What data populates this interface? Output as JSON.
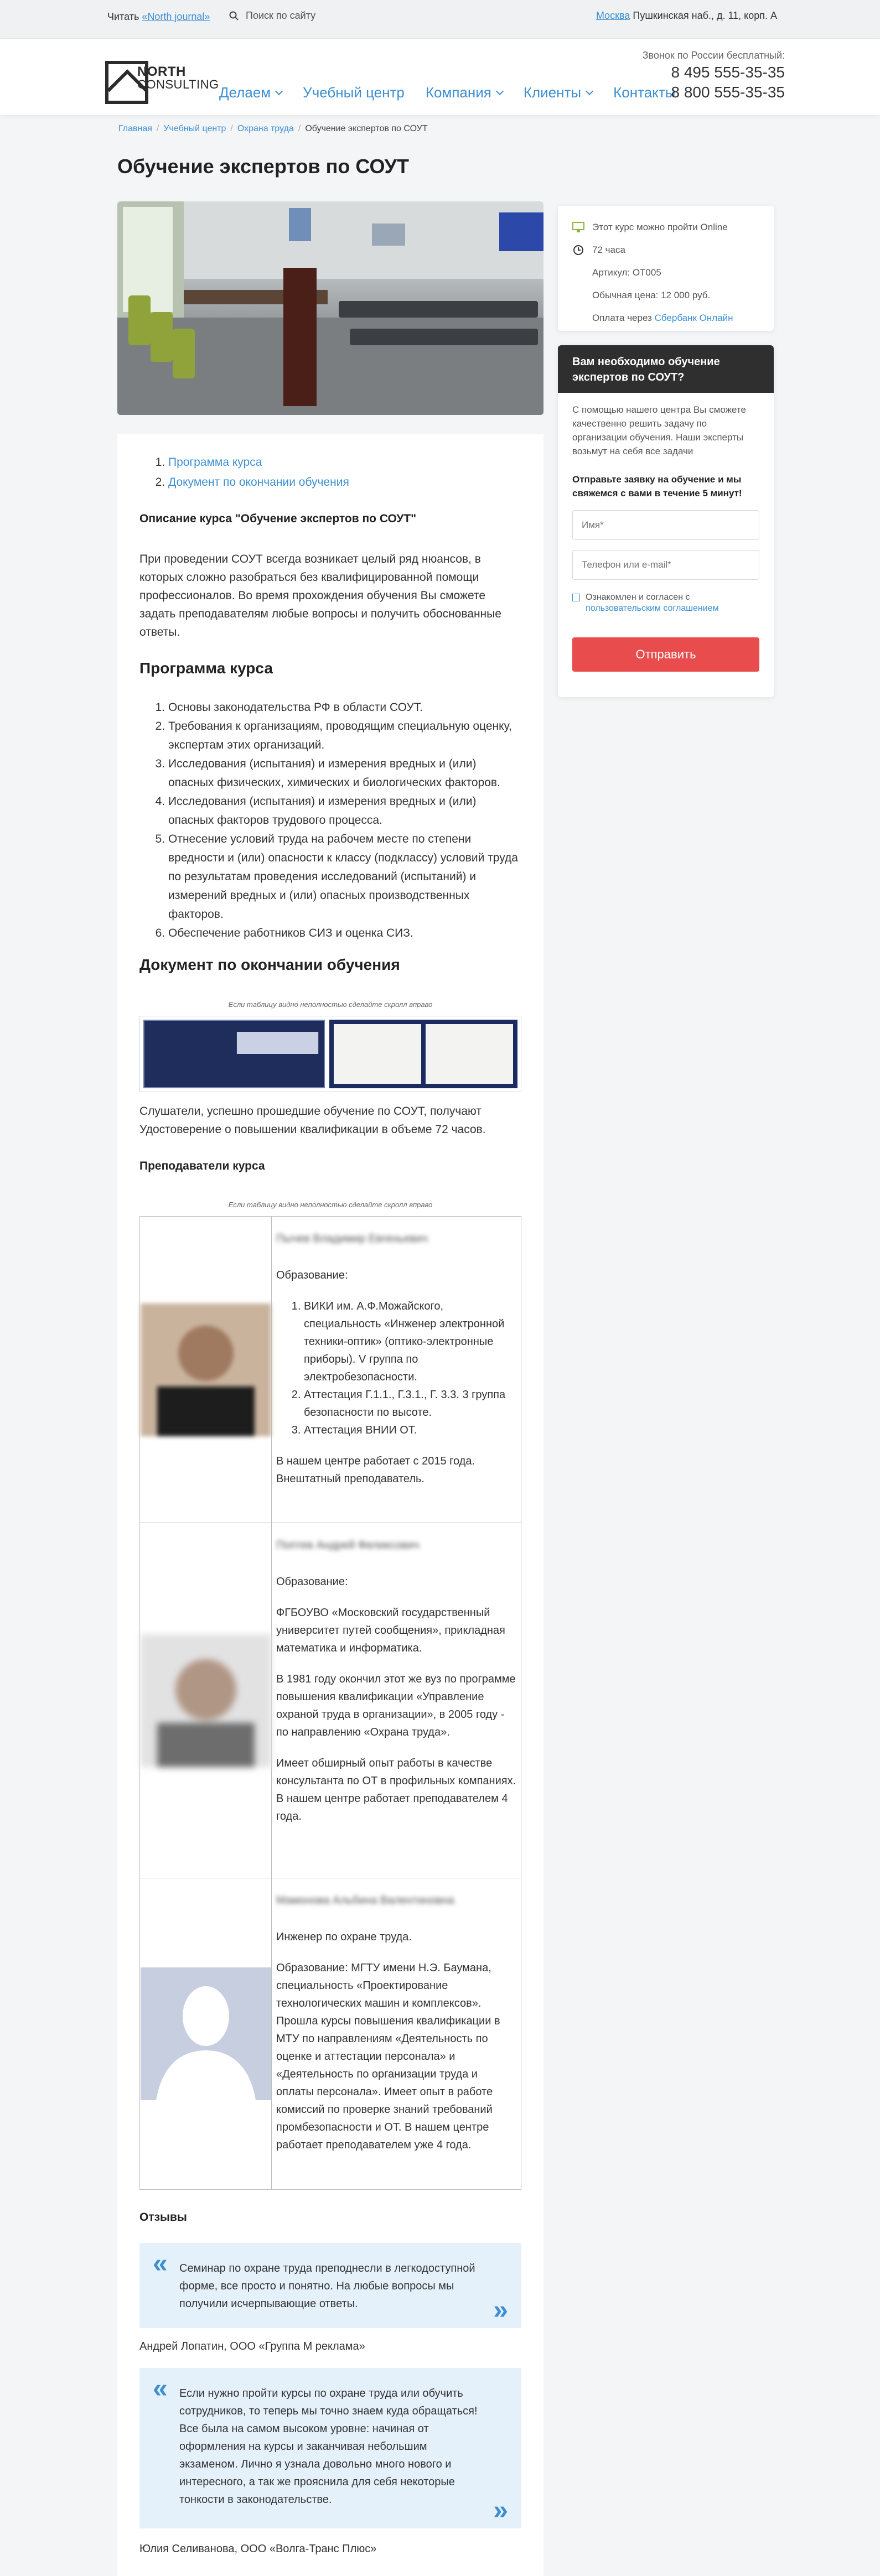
{
  "topbar": {
    "read_prefix": "Читать",
    "read_link": "«North journal»",
    "search_placeholder": "Поиск по сайту",
    "city": "Москва",
    "address": "Пушкинская наб., д. 11, корп. А"
  },
  "header": {
    "logo_line1": "NORTH",
    "logo_line2": "CONSULTING",
    "nav": [
      {
        "label": "Делаем",
        "dropdown": true
      },
      {
        "label": "Учебный центр",
        "dropdown": false
      },
      {
        "label": "Компания",
        "dropdown": true
      },
      {
        "label": "Клиенты",
        "dropdown": true
      },
      {
        "label": "Контакты",
        "dropdown": false
      }
    ],
    "phone_caption": "Звонок по России бесплатный:",
    "phone1": "8 495 555-35-35",
    "phone2": "8 800 555-35-35"
  },
  "breadcrumbs": [
    "Главная",
    "Учебный центр",
    "Охрана труда",
    "Обучение экспертов по СОУТ"
  ],
  "page_title": "Обучение экспертов по СОУТ",
  "info": {
    "online": "Этот курс можно пройти Online",
    "hours": "72 часа",
    "article": "Артикул: ОТ005",
    "price": "Обычная цена: 12 000 руб.",
    "payment_prefix": "Оплата через",
    "payment_link": "Сбербанк Онлайн"
  },
  "request": {
    "title": "Вам необходимо обучение экспертов по СОУТ?",
    "description": "С помощью нашего центра Вы сможете качественно решить задачу по организации обучения. Наши эксперты возьмут на себя все задачи",
    "call_text": "Отправьте заявку на обучение и мы свяжемся с вами в течение 5 минут!",
    "name_placeholder": "Имя*",
    "contact_placeholder": "Телефон или e-mail*",
    "agree_prefix": "Ознакомлен и согласен с",
    "agree_link": "пользовательским соглашением",
    "submit": "Отправить"
  },
  "toc": [
    "Программа курса",
    "Документ по окончании обучения"
  ],
  "description_title": "Описание курса \"Обучение экспертов по СОУТ\"",
  "description_text": "При проведении СОУТ всегда возникает целый ряд нюансов, в которых сложно разобраться без квалифицированной помощи профессионалов. Во время прохождения обучения Вы сможете задать преподавателям любые вопросы и получить обоснованные ответы.",
  "program_title": "Программа курса",
  "program": [
    "Основы законодательства РФ в области СОУТ.",
    "Требования к организациям, проводящим специальную оценку, экспертам этих организаций.",
    "Исследования (испытания) и измерения вредных и (или) опасных физических, химических и биологических факторов.",
    "Исследования (испытания) и измерения вредных и (или) опасных факторов трудового процесса.",
    "Отнесение условий труда на рабочем месте по степени вредности и (или) опасности к классу (подклассу) условий труда по результатам проведения исследований (испытаний) и измерений вредных и (или) опасных производственных факторов.",
    "Обеспечение работников СИЗ и оценка СИЗ."
  ],
  "document_title": "Документ по окончании обучения",
  "table_hint": "Если таблицу видно неполностью сделайте скролл вправо",
  "document_text": "Слушатели, успешно прошедшие обучение по СОУТ, получают Удостоверение о повышении квалификации в объеме 72 часов.",
  "teachers_title": "Преподаватели курса",
  "teachers": [
    {
      "name": "Пычев Владимир Евгеньевич",
      "edu_label": "Образование:",
      "list": [
        "ВИКИ им. А.Ф.Можайского, специальность «Инженер электронной техники-оптик» (оптико-электронные приборы). V группа по электробезопасности.",
        "Аттестация Г.1.1., Г.3.1., Г. 3.3. 3 группа безопасности по высоте.",
        "Аттестация ВНИИ ОТ."
      ],
      "paras": [
        "В нашем центре работает с 2015 года. Внештатный преподаватель."
      ]
    },
    {
      "name": "Поптев Андрей Феликсович",
      "edu_label": "Образование:",
      "list": [],
      "paras": [
        "ФГБОУВО «Московский государственный университет путей сообщения», прикладная математика и информатика.",
        "В 1981 году окончил этот же вуз по программе повышения квалификации «Управление охраной труда в организации», в 2005 году - по направлению «Охрана труда».",
        "Имеет обширный опыт работы в качестве консультанта по ОТ в профильных компаниях. В нашем центре работает преподавателем 4 года."
      ]
    },
    {
      "name": "Мамонова Альбина Валентиновна",
      "edu_label": "Инженер по охране труда.",
      "list": [],
      "paras": [
        "Образование: МГТУ имени Н.Э. Баумана, специальность «Проектирование технологических машин и комплексов». Прошла курсы повышения квалификации в МТУ по направлениям «Деятельность по оценке и аттестации персонала» и «Деятельность по организации труда и оплаты персонала». Имеет опыт в работе комиссий по проверке знаний требований промбезопасности и ОТ. В нашем центре работает преподавателем уже 4 года."
      ]
    }
  ],
  "reviews_title": "Отзывы",
  "reviews": [
    {
      "text": "Семинар по охране труда преподнесли в легкодоступной форме, все просто и понятно. На любые вопросы мы получили исчерпывающие ответы.",
      "author": "Андрей Лопатин, ООО «Группа М реклама»"
    },
    {
      "text": "Если нужно пройти курсы по охране труда или обучить сотрудников, то теперь мы точно знаем куда обращаться! Все была на самом высоком уровне: начиная от оформления на курсы и заканчивая небольшим экзаменом. Лично я узнала довольно много нового и интересного, а так же прояснила для себя некоторые тонкости в законодательстве.",
      "author": "Юлия Селиванова, ООО «Волга-Транс Плюс»"
    }
  ],
  "colors": {
    "accent": "#3d8fd1",
    "button": "#e84c4c",
    "review_bg": "#e4f1fb",
    "form_header": "#2f2f2f"
  }
}
